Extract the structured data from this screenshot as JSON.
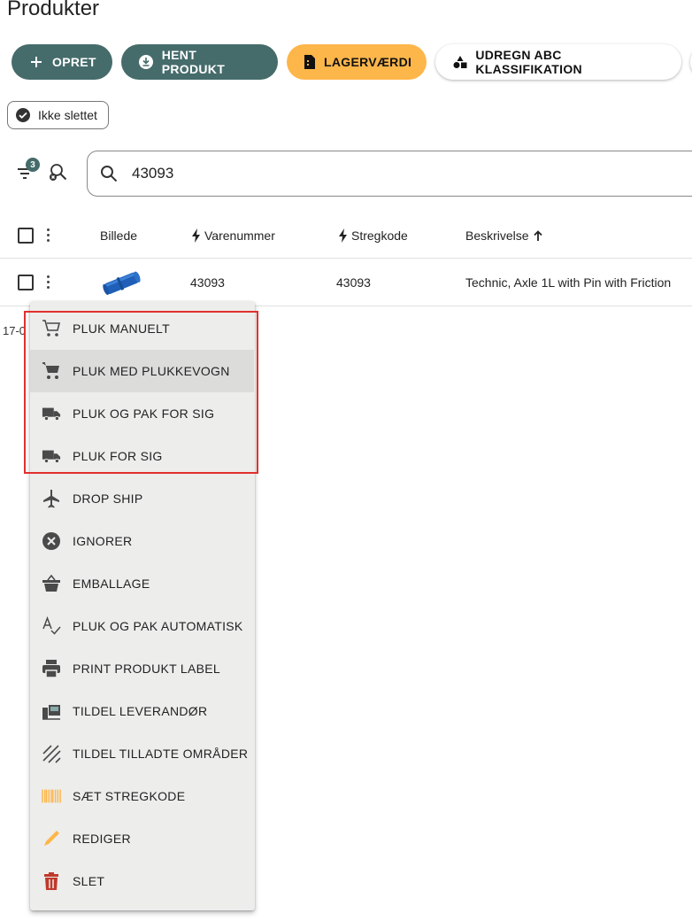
{
  "page": {
    "title": "Produkter"
  },
  "toolbar": {
    "create_label": "OPRET",
    "fetch_label": "HENT PRODUKT",
    "stock_value_label": "LAGERVÆRDI",
    "abc_label": "UDREGN ABC KLASSIFIKATION"
  },
  "chips": {
    "not_deleted": "Ikke slettet"
  },
  "filters": {
    "active_count": "3"
  },
  "search": {
    "value": "43093"
  },
  "table": {
    "columns": {
      "image": "Billede",
      "item_number": "Varenummer",
      "barcode": "Stregkode",
      "description": "Beskrivelse"
    },
    "rows": [
      {
        "item_number": "43093",
        "barcode": "43093",
        "description": "Technic, Axle 1L with Pin with Friction"
      }
    ]
  },
  "stray_text": "17-0",
  "menu": {
    "items": [
      {
        "label": "PLUK MANUELT",
        "icon": "cart-outline-icon"
      },
      {
        "label": "PLUK MED PLUKKEVOGN",
        "icon": "cart-icon"
      },
      {
        "label": "PLUK OG PAK FOR SIG",
        "icon": "truck-icon"
      },
      {
        "label": "PLUK FOR SIG",
        "icon": "truck-icon"
      },
      {
        "label": "DROP SHIP",
        "icon": "airplane-icon"
      },
      {
        "label": "IGNORER",
        "icon": "cancel-circle-icon"
      },
      {
        "label": "EMBALLAGE",
        "icon": "basket-icon"
      },
      {
        "label": "PLUK OG PAK AUTOMATISK",
        "icon": "spellcheck-icon"
      },
      {
        "label": "PRINT PRODUKT LABEL",
        "icon": "printer-icon"
      },
      {
        "label": "TILDEL LEVERANDØR",
        "icon": "truck-loading-icon"
      },
      {
        "label": "TILDEL TILLADTE OMRÅDER",
        "icon": "hatch-area-icon"
      },
      {
        "label": "SÆT STREGKODE",
        "icon": "barcode-icon"
      },
      {
        "label": "REDIGER",
        "icon": "pencil-icon"
      },
      {
        "label": "SLET",
        "icon": "trash-icon"
      }
    ]
  },
  "colors": {
    "primary": "#466b6b",
    "orange": "#fdb64a",
    "menu_bg": "#ededec",
    "highlight_border": "#e0302e",
    "delete_red": "#c0392b",
    "barcode_orange": "#fdb64a"
  }
}
